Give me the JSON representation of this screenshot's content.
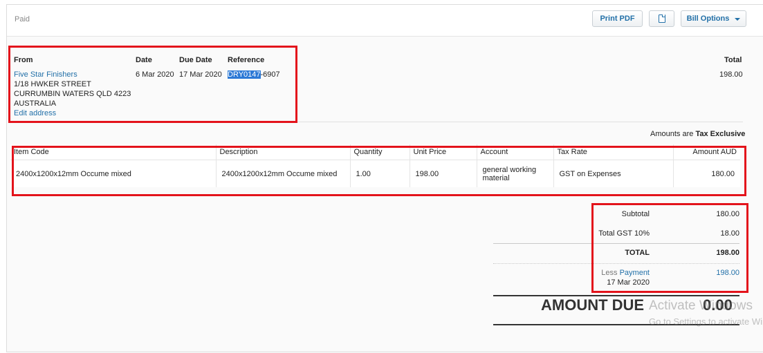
{
  "header": {
    "status": "Paid",
    "print_pdf_label": "Print PDF",
    "copy_icon": "copy-icon",
    "bill_options_label": "Bill Options"
  },
  "bill": {
    "from_label": "From",
    "date_label": "Date",
    "due_date_label": "Due Date",
    "reference_label": "Reference",
    "total_label": "Total",
    "supplier_name": "Five Star Finishers",
    "address_line1": "1/18 HWKER STREET",
    "address_line2": "CURRUMBIN WATERS QLD 4223",
    "address_line3": "AUSTRALIA",
    "edit_address": "Edit address",
    "date": "6 Mar 2020",
    "due_date": "17 Mar 2020",
    "reference_selected": "DRY0147",
    "reference_rest": "-6907",
    "total": "198.00"
  },
  "tax_mode": {
    "prefix": "Amounts are",
    "value": "Tax Exclusive"
  },
  "items_table": {
    "columns": [
      "Item Code",
      "Description",
      "Quantity",
      "Unit Price",
      "Account",
      "Tax Rate",
      "Amount AUD"
    ],
    "rows": [
      {
        "item_code": "2400x1200x12mm Occume mixed",
        "description": "2400x1200x12mm Occume mixed",
        "quantity": "1.00",
        "unit_price": "198.00",
        "account_line1": "general working",
        "account_line2": "material",
        "tax_rate": "GST on Expenses",
        "amount": "180.00"
      }
    ]
  },
  "totals": {
    "subtotal_label": "Subtotal",
    "subtotal": "180.00",
    "gst_label": "Total GST  10%",
    "gst": "18.00",
    "total_label": "TOTAL",
    "total": "198.00",
    "less_label": "Less",
    "payment_link": "Payment",
    "payment_date": "17 Mar 2020",
    "payment_amount": "198.00",
    "amount_due_label": "AMOUNT DUE",
    "amount_due": "0.00"
  },
  "watermark": {
    "line1": "Activate Windows",
    "line2": "Go to Settings to activate Windows."
  },
  "colors": {
    "highlight_red": "#e3131b",
    "link_blue": "#2270a8"
  }
}
